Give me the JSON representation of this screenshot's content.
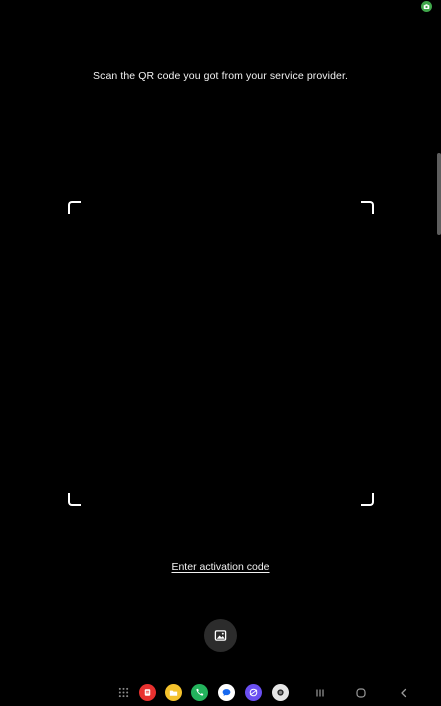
{
  "status_bar": {
    "camera_indicator_icon": "camera-icon",
    "camera_indicator_color": "#3fa64a"
  },
  "scanner": {
    "instruction": "Scan the QR code you got from your service provider.",
    "corner_color": "#ffffff",
    "enter_code_link": "Enter activation code",
    "gallery_button_icon": "image-gallery-icon"
  },
  "taskbar": {
    "apps_button_icon": "app-drawer-icon",
    "apps": [
      {
        "name": "samsung-notes",
        "color": "#e8312f"
      },
      {
        "name": "my-files",
        "color": "#f4c22c"
      },
      {
        "name": "phone",
        "color": "#23b35c"
      },
      {
        "name": "messages",
        "color": "#ffffff"
      },
      {
        "name": "internet",
        "color": "#6a4ff2"
      },
      {
        "name": "camera",
        "color": "#e6e6e6"
      }
    ],
    "nav": [
      "recents-icon",
      "home-icon",
      "back-icon"
    ]
  }
}
